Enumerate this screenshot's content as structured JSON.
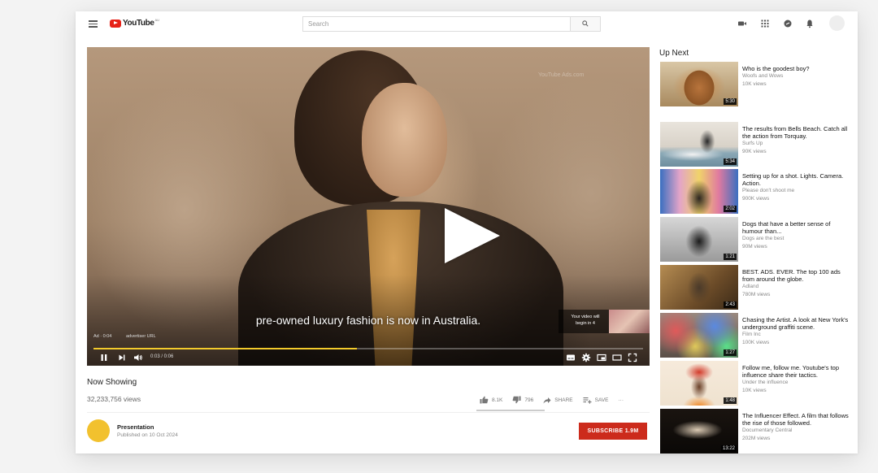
{
  "header": {
    "logo_text": "YouTube",
    "logo_region": "AU",
    "search_placeholder": "Search"
  },
  "player": {
    "subtitle": "pre-owned luxury fashion is now in Australia.",
    "watermark": "YouTube Ads.com",
    "ad_label": "Ad · 0:04",
    "advertiser_url": "advertiser URL",
    "skip_text_1": "Your video will",
    "skip_text_2": "begin in 4",
    "time": "0:03 / 0:06",
    "progress": 0.48,
    "accent_color": "#f3cb2c"
  },
  "video": {
    "title": "Now Showing",
    "views": "32,233,756 views",
    "likes": "8.1K",
    "dislikes": "796",
    "share_label": "SHARE",
    "save_label": "SAVE",
    "more_label": "···"
  },
  "channel": {
    "name": "Presentation",
    "published": "Published on 10 Oct 2024",
    "subscribe_label": "SUBSCRIBE  1.9M",
    "subscribe_color": "#cc2b1c",
    "avatar_color": "#f2c12e"
  },
  "sidebar": {
    "title": "Up Next",
    "items": [
      {
        "title": "Who is the goodest boy?",
        "channel": "Woofs and Wows",
        "views": "10K views",
        "duration": "5:30"
      },
      {
        "title": "The results from Bells Beach. Catch all the action from Torquay.",
        "channel": "Surfs Up",
        "views": "90K views",
        "duration": "5:34"
      },
      {
        "title": "Setting up for a shot. Lights. Camera. Action.",
        "channel": "Please don't shoot me",
        "views": "900K views",
        "duration": "2:02"
      },
      {
        "title": "Dogs that have a better sense of humour than...",
        "channel": "Dogs are the best",
        "views": "90M views",
        "duration": "1:21"
      },
      {
        "title": "BEST. ADS. EVER. The top 100 ads from around the globe.",
        "channel": "Adland",
        "views": "780M views",
        "duration": "2:43"
      },
      {
        "title": "Chasing the Artist. A look at New York's underground graffiti scene.",
        "channel": "Film Inc",
        "views": "100K views",
        "duration": "1:27"
      },
      {
        "title": "Follow me, follow me. Youtube's top influence share their tactics.",
        "channel": "Under the influence",
        "views": "10K views",
        "duration": "1:48"
      },
      {
        "title": "The Influencer Effect. A film that follows the rise of those followed.",
        "channel": "Documentary Central",
        "views": "202M views",
        "duration": "13:22"
      }
    ]
  }
}
